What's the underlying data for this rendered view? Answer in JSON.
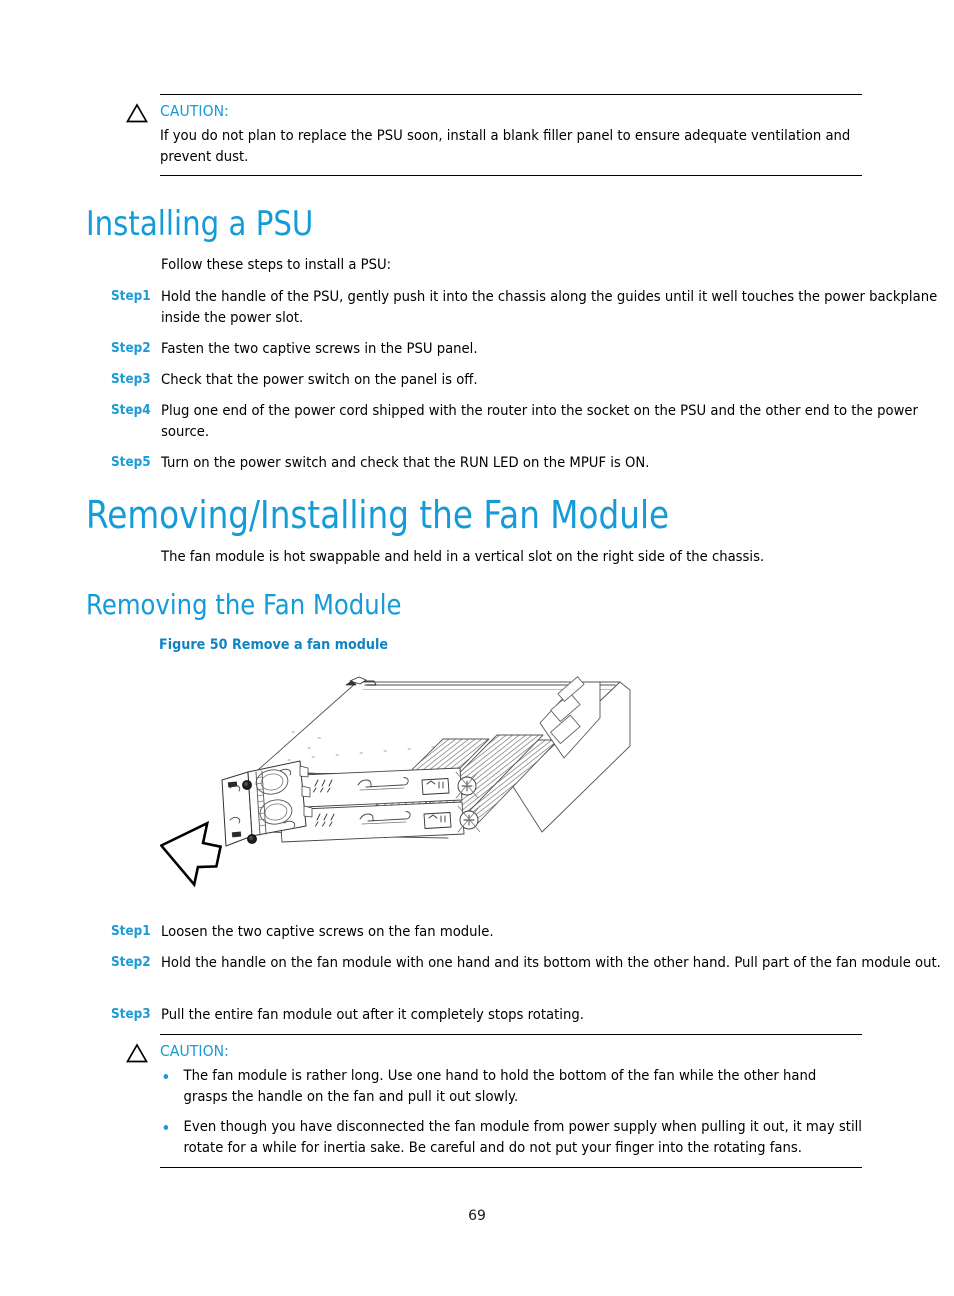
{
  "page": {
    "number": "69"
  },
  "caution_top": {
    "icon": "caution-triangle-icon",
    "label": "CAUTION:",
    "body": "If you do not plan to replace the PSU soon, install a blank filler panel to ensure adequate ventilation and prevent dust."
  },
  "section_installing_psu": {
    "heading": "Installing a PSU",
    "intro": "Follow these steps to install a PSU:",
    "steps": [
      {
        "label": "Step1",
        "text": "Hold the handle of the PSU, gently push it into the chassis along the guides until it well touches the power backplane inside the power slot."
      },
      {
        "label": "Step2",
        "text": "Fasten the two captive screws in the PSU panel."
      },
      {
        "label": "Step3",
        "text": "Check that the power switch on the panel is off."
      },
      {
        "label": "Step4",
        "text": "Plug one end of the power cord shipped with the router into the socket on the PSU and the other end to the power source."
      },
      {
        "label": "Step5",
        "text": "Turn on the power switch and check that the RUN LED on the MPUF is ON."
      }
    ]
  },
  "section_fan_module": {
    "heading": "Removing/Installing the Fan Module",
    "intro": "The fan module is hot swappable and held in a vertical slot on the right side of the chassis."
  },
  "section_removing_fan": {
    "heading": "Removing the Fan Module",
    "figure_caption": "Figure 50 Remove a fan module",
    "figure_alt": "Isometric line drawing of a rack-mount router chassis with the fan module being pulled out toward the lower left, indicated by a large hollow arrow",
    "steps": [
      {
        "label": "Step1",
        "text": "Loosen the two captive screws on the fan module."
      },
      {
        "label": "Step2",
        "text": "Hold the handle on the fan module with one hand and its bottom with the other hand. Pull part of the fan module out."
      },
      {
        "label": "Step3",
        "text": "Pull the entire fan module out after it completely stops rotating."
      }
    ]
  },
  "caution_bottom": {
    "icon": "caution-triangle-icon",
    "label": "CAUTION:",
    "bullets": [
      "The fan module is rather long. Use one hand to hold the bottom of the fan while the other hand grasps the handle on the fan and pull it out slowly.",
      "Even though you have disconnected the fan module from power supply when pulling it out, it may still rotate for a while for inertia sake. Be careful and do not put your finger into the rotating fans."
    ]
  },
  "colors": {
    "heading_blue": "#159BD7",
    "accent_blue": "#1C9AD6",
    "caption_blue": "#0E84C4",
    "text_black": "#000000"
  }
}
